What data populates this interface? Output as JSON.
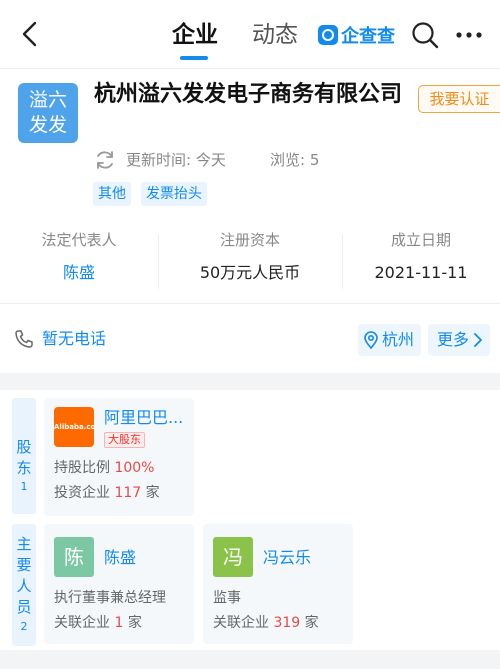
{
  "header": {
    "tab_company": "企业",
    "tab_news": "动态",
    "brand": "企查查"
  },
  "company": {
    "logo_line1": "溢六",
    "logo_line2": "发发",
    "name": "杭州溢六发发电子商务有限公司",
    "verify_label": "我要认证",
    "update_text": "更新时间: 今天",
    "views_text": "浏览: 5",
    "tags": [
      "其他",
      "发票抬头"
    ]
  },
  "stats": [
    {
      "label": "法定代表人",
      "value": "陈盛"
    },
    {
      "label": "注册资本",
      "value": "50万元人民币"
    },
    {
      "label": "成立日期",
      "value": "2021-11-11"
    }
  ],
  "contact": {
    "phone_text": "暂无电话",
    "city": "杭州",
    "more_label": "更多"
  },
  "shareholders": {
    "side_label": [
      "股",
      "东"
    ],
    "count": "1",
    "items": [
      {
        "logo_text": "Alibaba.com",
        "name": "阿里巴巴...",
        "badge": "大股东",
        "ratio_label": "持股比例 ",
        "ratio_value": "100%",
        "invest_label": "投资企业 ",
        "invest_value": "117",
        "invest_unit": " 家"
      }
    ]
  },
  "staff": {
    "side_label": [
      "主",
      "要",
      "人",
      "员"
    ],
    "count": "2",
    "items": [
      {
        "avatar": "陈",
        "name": "陈盛",
        "role": "执行董事兼总经理",
        "rel_label": "关联企业 ",
        "rel_value": "1",
        "rel_unit": " 家"
      },
      {
        "avatar": "冯",
        "name": "冯云乐",
        "role": "监事",
        "rel_label": "关联企业 ",
        "rel_value": "319",
        "rel_unit": " 家"
      }
    ]
  },
  "colors": {
    "accent": "#128bed",
    "verify": "#f08c1b",
    "highlight": "#e84a4a"
  }
}
